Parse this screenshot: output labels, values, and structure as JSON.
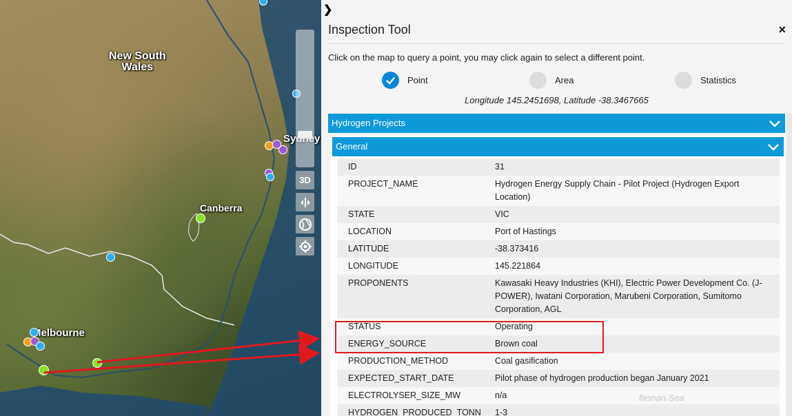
{
  "map": {
    "places": [
      {
        "name": "nsw",
        "label": "New South\nWales"
      },
      {
        "name": "canberra",
        "label": "Canberra"
      },
      {
        "name": "sydney",
        "label": "Sydney"
      },
      {
        "name": "melbourne",
        "label": "Melbourne"
      }
    ],
    "buttons": {
      "three_d": "3D"
    },
    "icons": {
      "split": "split-view-icon",
      "globe": "globe-icon",
      "locate": "locate-icon"
    },
    "colors": {
      "blue_point": "#2ab0ee",
      "green_point": "#8ee02a",
      "purple_point": "#9b58d6",
      "orange_point": "#f0a020",
      "arrow": "#e0191e"
    }
  },
  "panel": {
    "toggle": "❯",
    "title": "Inspection Tool",
    "close": "×",
    "instructions": "Click on the map to query a point, you may click again to select a different point.",
    "modes": [
      {
        "label": "Point",
        "selected": true
      },
      {
        "label": "Area",
        "selected": false
      },
      {
        "label": "Statistics",
        "selected": false
      }
    ],
    "coordinates": "Longitude 145.2451698, Latitude -38.3467665",
    "section": "Hydrogen Projects",
    "subsection": "General",
    "attributes": [
      {
        "key": "ID",
        "value": "31"
      },
      {
        "key": "PROJECT_NAME",
        "value": "Hydrogen Energy Supply Chain - Pilot Project (Hydrogen Export Location)"
      },
      {
        "key": "STATE",
        "value": "VIC"
      },
      {
        "key": "LOCATION",
        "value": "Port of Hastings"
      },
      {
        "key": "LATITUDE",
        "value": "-38.373416"
      },
      {
        "key": "LONGITUDE",
        "value": "145.221864"
      },
      {
        "key": "PROPONENTS",
        "value": "Kawasaki Heavy Industries (KHI), Electric Power Development Co. (J-POWER), Iwatani Corporation, Marubeni Corporation, Sumitomo Corporation, AGL"
      },
      {
        "key": "STATUS",
        "value": "Operating"
      },
      {
        "key": "ENERGY_SOURCE",
        "value": "Brown coal"
      },
      {
        "key": "PRODUCTION_METHOD",
        "value": "Coal gasification"
      },
      {
        "key": "EXPECTED_START_DATE",
        "value": "Pilot phase of hydrogen production began January 2021"
      },
      {
        "key": "ELECTROLYSER_SIZE_MW",
        "value": "n/a"
      },
      {
        "key": "HYDROGEN_PRODUCED_TONNES_PER_YEAR",
        "value": "1-3"
      }
    ],
    "watermark": "fasnan.Sea"
  }
}
